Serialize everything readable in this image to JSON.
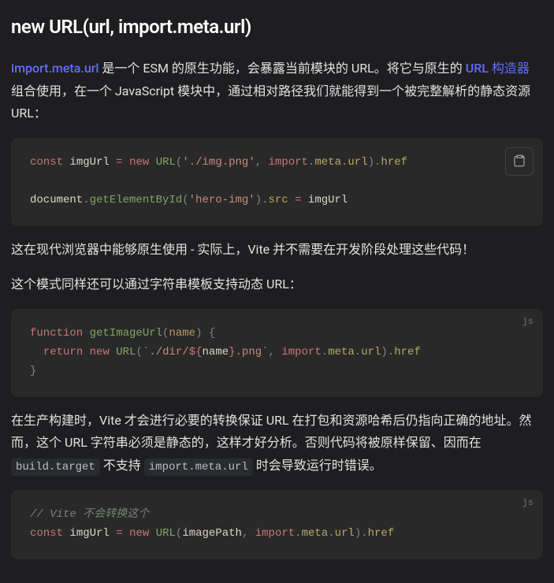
{
  "heading": "new URL(url, import.meta.url)",
  "intro": {
    "link1_text": "import.meta.url",
    "part1": " 是一个 ESM 的原生功能，会暴露当前模块的 URL。将它与原生的 ",
    "link2_text": "URL 构造器",
    "part2": " 组合使用，在一个 JavaScript 模块中，通过相对路径我们就能得到一个被完整解析的静态资源 URL："
  },
  "code1": {
    "l1": {
      "kw": "const",
      "v": "imgUrl",
      "eq": "=",
      "new": "new",
      "cls": "URL",
      "lp": "(",
      "s": "'./img.png'",
      "c": ",",
      "imp": "import",
      "d1": ".",
      "meta": "meta",
      "d2": ".",
      "url": "url",
      "rp": ")",
      "d3": ".",
      "href": "href"
    },
    "l2": {
      "doc": "document",
      "d1": ".",
      "fn": "getElementById",
      "lp": "(",
      "s": "'hero-img'",
      "rp": ")",
      "d2": ".",
      "src": "src",
      "eq": "=",
      "v": "imgUrl"
    }
  },
  "para2": "这在现代浏览器中能够原生使用 - 实际上，Vite 并不需要在开发阶段处理这些代码！",
  "para3": "这个模式同样还可以通过字符串模板支持动态 URL：",
  "code2": {
    "lang": "js",
    "l1": {
      "kw": "function",
      "fn": "getImageUrl",
      "lp": "(",
      "p": "name",
      "rp": ")",
      "lb": "{"
    },
    "l2": {
      "ret": "return",
      "new": "new",
      "cls": "URL",
      "lp": "(",
      "bt1": "`./dir/",
      "il": "${",
      "v": "name",
      "ir": "}",
      "bt2": ".png`",
      "c": ",",
      "imp": "import",
      "d1": ".",
      "meta": "meta",
      "d2": ".",
      "url": "url",
      "rp": ")",
      "d3": ".",
      "href": "href"
    },
    "l3": {
      "rb": "}"
    }
  },
  "para4": {
    "p1": "在生产构建时，Vite 才会进行必要的转换保证 URL 在打包和资源哈希后仍指向正确的地址。然而，这个 URL 字符串必须是静态的，这样才好分析。否则代码将被原样保留、因而在 ",
    "c1": "build.target",
    "p2": " 不支持 ",
    "c2": "import.meta.url",
    "p3": " 时会导致运行时错误。"
  },
  "code3": {
    "lang": "js",
    "l1": {
      "cm": "// Vite 不会转换这个"
    },
    "l2": {
      "kw": "const",
      "v": "imgUrl",
      "eq": "=",
      "new": "new",
      "cls": "URL",
      "lp": "(",
      "arg": "imagePath",
      "c": ",",
      "imp": "import",
      "d1": ".",
      "meta": "meta",
      "d2": ".",
      "url": "url",
      "rp": ")",
      "d3": ".",
      "href": "href"
    }
  }
}
